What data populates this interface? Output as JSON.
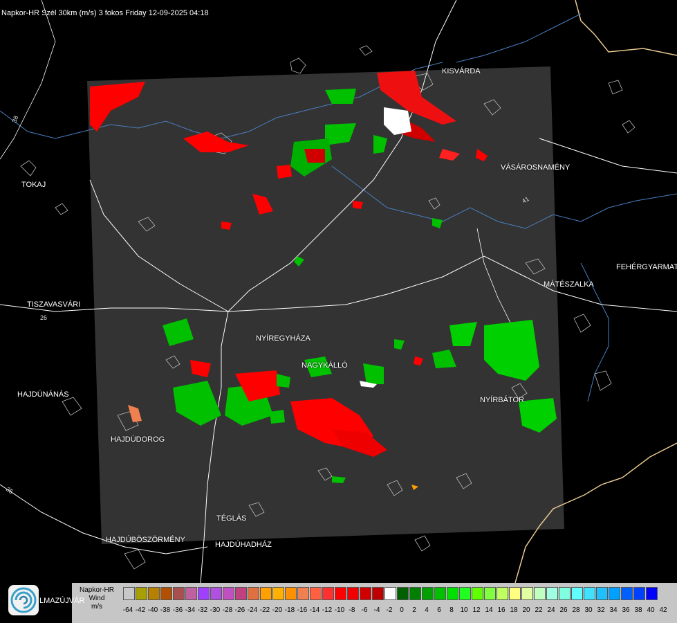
{
  "title": "Napkor-HR Szél 30km (m/s) 3 fokos Friday 12-09-2025 04:18",
  "places": [
    {
      "name": "KISVÁRDA"
    },
    {
      "name": "VÁSÁROSNAMÉNY"
    },
    {
      "name": "TOKAJ"
    },
    {
      "name": "FEHÉRGYARMAT"
    },
    {
      "name": "MÁTÉSZALKA"
    },
    {
      "name": "TISZAVASVÁRI"
    },
    {
      "name": "NYÍREGYHÁZA"
    },
    {
      "name": "NAGYKÁLLÓ"
    },
    {
      "name": "HAJDÚNÁNÁS"
    },
    {
      "name": "NYÍRBÁTOR"
    },
    {
      "name": "HAJDÚDOROG"
    },
    {
      "name": "TÉGLÁS"
    },
    {
      "name": "HAJDÚBÖSZÖRMÉNY"
    },
    {
      "name": "HAJDÚHADHÁZ"
    }
  ],
  "road_numbers": [
    "38",
    "26",
    "35",
    "41"
  ],
  "legend": {
    "line1": "Napkor-HR",
    "line2": "Wind",
    "unit": "m/s",
    "values": [
      "-64",
      "-42",
      "-40",
      "-38",
      "-36",
      "-34",
      "-32",
      "-30",
      "-28",
      "-26",
      "-24",
      "-22",
      "-20",
      "-18",
      "-16",
      "-14",
      "-12",
      "-10",
      "-8",
      "-6",
      "-4",
      "-2",
      "0",
      "2",
      "4",
      "6",
      "8",
      "10",
      "12",
      "14",
      "16",
      "18",
      "20",
      "22",
      "24",
      "26",
      "28",
      "30",
      "32",
      "34",
      "36",
      "38",
      "40",
      "42"
    ],
    "colors": [
      "#c8c8c8",
      "#a8a000",
      "#b88000",
      "#b05000",
      "#a85050",
      "#c060a0",
      "#a040ff",
      "#b050e0",
      "#c050c0",
      "#c04080",
      "#e07040",
      "#ffa000",
      "#ffb000",
      "#ff9000",
      "#f08050",
      "#ff6040",
      "#ff3030",
      "#ff0000",
      "#f00000",
      "#d00000",
      "#c00000",
      "#ffffff",
      "#006000",
      "#008000",
      "#00a000",
      "#00c000",
      "#00e000",
      "#20ff20",
      "#60ff00",
      "#80ff40",
      "#c0ff60",
      "#ffff80",
      "#e0ffa0",
      "#c0ffc0",
      "#a0ffe0",
      "#80ffe0",
      "#60ffff",
      "#40e0ff",
      "#20c0ff",
      "#00a0ff",
      "#0060ff",
      "#0040ff",
      "#0000ff"
    ]
  },
  "logo_text": "LMAZÚJVÁR",
  "colors": {
    "radar_bg": "#333333",
    "red": "#ff0000",
    "green": "#00d000"
  }
}
